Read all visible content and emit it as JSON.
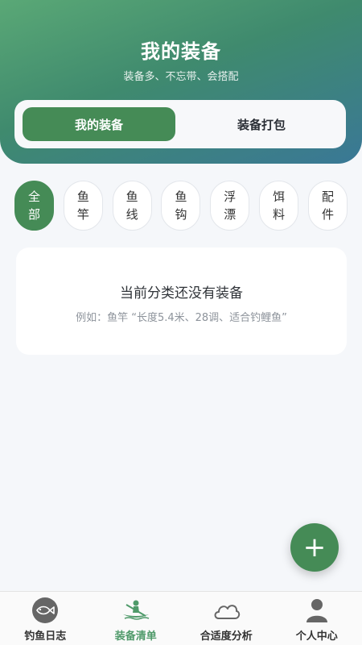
{
  "header": {
    "title": "我的装备",
    "subtitle": "装备多、不忘带、会搭配"
  },
  "segments": [
    {
      "label": "我的装备",
      "active": true
    },
    {
      "label": "装备打包",
      "active": false
    }
  ],
  "categories": [
    {
      "line1": "全",
      "line2": "部",
      "active": true
    },
    {
      "line1": "鱼",
      "line2": "竿",
      "active": false
    },
    {
      "line1": "鱼",
      "line2": "线",
      "active": false
    },
    {
      "line1": "鱼",
      "line2": "钩",
      "active": false
    },
    {
      "line1": "浮",
      "line2": "漂",
      "active": false
    },
    {
      "line1": "饵",
      "line2": "料",
      "active": false
    },
    {
      "line1": "配",
      "line2": "件",
      "active": false
    }
  ],
  "empty_state": {
    "title": "当前分类还没有装备",
    "hint": "例如：鱼竿 “长度5.4米、28调、适合钓鲤鱼”"
  },
  "fab": {
    "label": "+"
  },
  "tabbar": [
    {
      "label": "钓鱼日志",
      "icon": "fish-icon",
      "active": false
    },
    {
      "label": "装备清单",
      "icon": "kayak-icon",
      "active": true
    },
    {
      "label": "合适度分析",
      "icon": "cloud-icon",
      "active": false
    },
    {
      "label": "个人中心",
      "icon": "person-icon",
      "active": false
    }
  ],
  "colors": {
    "accent": "#458b56",
    "active_tab_label": "#4f9a6a"
  }
}
